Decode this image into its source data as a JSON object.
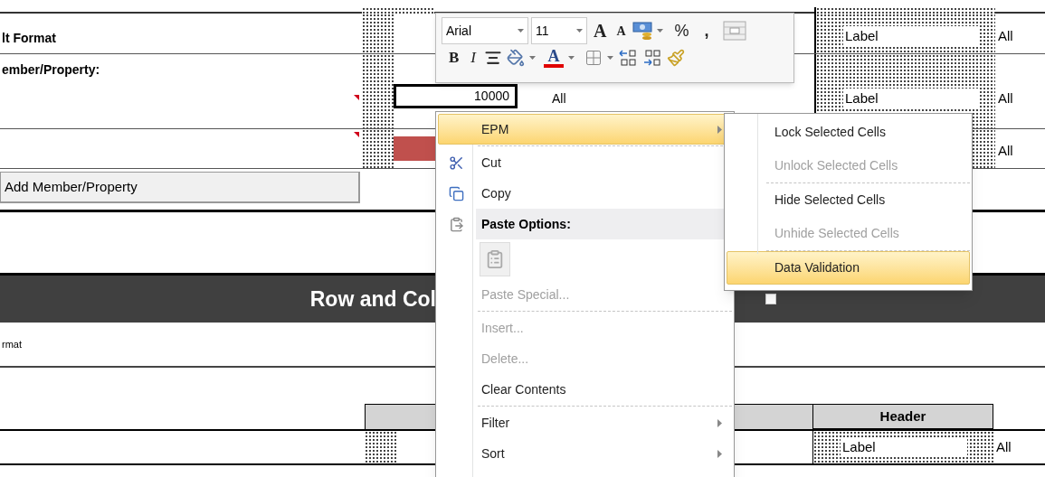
{
  "sheet": {
    "rows": [
      {
        "kind": "top",
        "label": "lt Format",
        "right_label": "Label",
        "right_value": "All"
      },
      {
        "kind": "member",
        "label": "ember/Property:",
        "cell_value": "10000",
        "cell_note": "All",
        "right_label": "Label",
        "right_value": "All",
        "comment": true
      },
      {
        "kind": "color",
        "right_value": "All",
        "comment": true
      }
    ],
    "add_button": "Add Member/Property",
    "band": {
      "title": "Row and Col",
      "checkbox": {
        "checked": false
      }
    },
    "subtitle": "rmat",
    "header": "Header",
    "data_row": {
      "label": "Label",
      "value": "All"
    }
  },
  "mini_toolbar": {
    "font": "Arial",
    "size": "11",
    "grow": "A",
    "shrink": "A",
    "percent": "%",
    "comma": ",",
    "bold": "B",
    "italic": "I",
    "font_color_glyph": "A"
  },
  "context_menu": [
    {
      "kind": "item",
      "label": "EPM",
      "selected": true,
      "disabled": false,
      "submenu": true
    },
    {
      "kind": "separator"
    },
    {
      "kind": "item",
      "label": "Cut",
      "selected": false,
      "disabled": false,
      "submenu": false
    },
    {
      "kind": "item",
      "label": "Copy",
      "selected": false,
      "disabled": false,
      "submenu": false
    },
    {
      "kind": "header",
      "label": "Paste Options:"
    },
    {
      "kind": "paste-icons"
    },
    {
      "kind": "item",
      "label": "Paste Special...",
      "selected": false,
      "disabled": true,
      "submenu": false
    },
    {
      "kind": "separator"
    },
    {
      "kind": "item",
      "label": "Insert...",
      "selected": false,
      "disabled": true,
      "submenu": false
    },
    {
      "kind": "item",
      "label": "Delete...",
      "selected": false,
      "disabled": true,
      "submenu": false
    },
    {
      "kind": "item",
      "label": "Clear Contents",
      "selected": false,
      "disabled": false,
      "submenu": false
    },
    {
      "kind": "separator"
    },
    {
      "kind": "item",
      "label": "Filter",
      "selected": false,
      "disabled": false,
      "submenu": true
    },
    {
      "kind": "item",
      "label": "Sort",
      "selected": false,
      "disabled": false,
      "submenu": true
    }
  ],
  "submenu": [
    {
      "kind": "item",
      "label": "Lock Selected Cells",
      "selected": false,
      "disabled": false
    },
    {
      "kind": "item",
      "label": "Unlock Selected Cells",
      "selected": false,
      "disabled": true
    },
    {
      "kind": "separator"
    },
    {
      "kind": "item",
      "label": "Hide Selected Cells",
      "selected": false,
      "disabled": false
    },
    {
      "kind": "item",
      "label": "Unhide Selected Cells",
      "selected": false,
      "disabled": true
    },
    {
      "kind": "separator"
    },
    {
      "kind": "item",
      "label": "Data Validation",
      "selected": true,
      "disabled": false
    }
  ]
}
